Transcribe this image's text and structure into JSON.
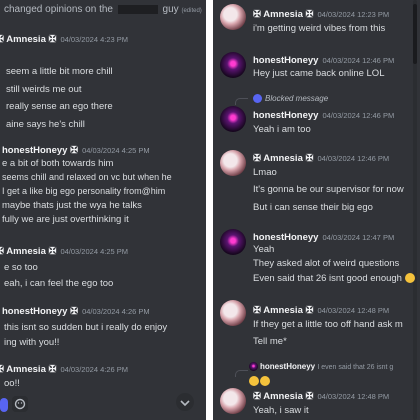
{
  "left": {
    "top_snippet_before": "changed opinions on the",
    "top_snippet_after": "guy",
    "top_snippet_edited": "(edited)",
    "amnesia_name": "✠ Amnesia ✠",
    "honey_name": "honestHoneyy ✠",
    "msgs": [
      {
        "time": "04/03/2024 4:23 PM",
        "lines": [
          "seem a little bit more chill",
          "still weirds me out",
          "really sense an ego there",
          "aine says he's chill"
        ]
      },
      {
        "time": "04/03/2024 4:25 PM",
        "lines": [
          "e a bit of both towards him",
          "seems chill and relaxed on vc but when he",
          "I get a like big ego personality from@him",
          "maybe thats just the wya he talks",
          "fully we are just overthinking it"
        ]
      },
      {
        "time": "04/03/2024 4:25 PM",
        "lines": [
          "e so too",
          "eah, i can feel the ego too"
        ]
      },
      {
        "time": "04/03/2024 4:26 PM",
        "lines": [
          "this isnt so sudden but i really do enjoy",
          "ing with you!!"
        ]
      },
      {
        "time": "04/03/2024 4:26 PM",
        "lines": [
          "oo!!"
        ]
      }
    ]
  },
  "right": {
    "amnesia_name": "✠ Amnesia ✠",
    "honey_name": "honestHoneyy",
    "blocked_label": "Blocked message",
    "reply_name": "honestHoneyy",
    "reply_text": "I even said that 26 isnt g",
    "msgs": [
      {
        "time": "04/03/2024 12:23 PM",
        "lines": [
          "i'm getting weird vibes from this"
        ]
      },
      {
        "time": "04/03/2024 12:46 PM",
        "lines": [
          "Hey just came back online LOL"
        ]
      },
      {
        "time": "04/03/2024 12:46 PM",
        "lines": [
          "Yeah i am too"
        ]
      },
      {
        "time": "04/03/2024 12:46 PM",
        "lines": [
          "Lmao",
          "It's gonna be our supervisor for now",
          "But i can sense their big ego"
        ]
      },
      {
        "time": "04/03/2024 12:47 PM",
        "lines": [
          "Yeah",
          "They asked alot of weird questions",
          "Even said that 26 isnt good enough"
        ]
      },
      {
        "time": "04/03/2024 12:48 PM",
        "lines": [
          "If they get a little too off hand ask m",
          "Tell me*"
        ]
      },
      {
        "time": "04/03/2024 12:48 PM",
        "lines": [
          "Yeah, i saw it"
        ]
      }
    ]
  },
  "colors": {
    "background": "#313338",
    "username": "#f2f3f5",
    "timestamp": "#949ba4",
    "text": "#dbdee1",
    "blurple": "#5865f2"
  },
  "icons": {
    "scroll": "arrow-down-icon",
    "blocked": "discord-logo-icon",
    "emoji": "grimacing-emoji-icon"
  }
}
